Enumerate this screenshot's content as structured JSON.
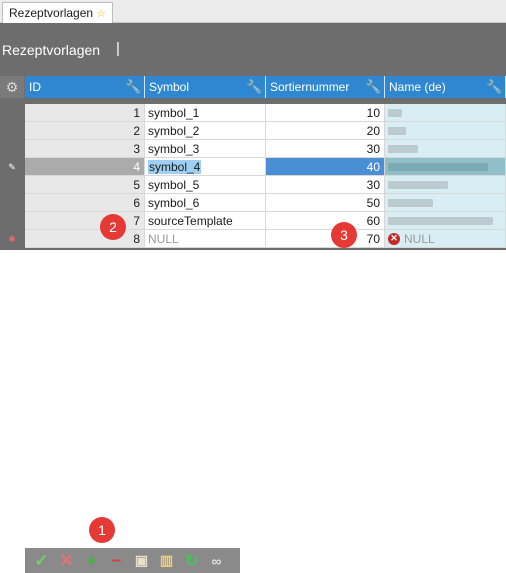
{
  "tab": {
    "label": "Rezeptvorlagen"
  },
  "header": {
    "title": "Rezeptvorlagen",
    "cursor": "|"
  },
  "grid": {
    "columns": [
      "ID",
      "Symbol",
      "Sortiernummer",
      "Name (de)"
    ],
    "rows": [
      {
        "id": "1",
        "symbol": "symbol_1",
        "sort": "10"
      },
      {
        "id": "2",
        "symbol": "symbol_2",
        "sort": "20"
      },
      {
        "id": "3",
        "symbol": "symbol_3",
        "sort": "30"
      },
      {
        "id": "4",
        "symbol": "symbol_4",
        "sort": "40"
      },
      {
        "id": "5",
        "symbol": "symbol_5",
        "sort": "30"
      },
      {
        "id": "6",
        "symbol": "symbol_6",
        "sort": "50"
      },
      {
        "id": "7",
        "symbol": "sourceTemplate",
        "sort": "60"
      },
      {
        "id": "8",
        "symbol": "NULL",
        "sort": "70",
        "name": "NULL"
      }
    ]
  },
  "badges": {
    "one": "1",
    "two": "2",
    "three": "3"
  },
  "colors": {
    "header_blue": "#2f87d1",
    "selected_blue": "#4a8fd4",
    "badge_red": "#e53935"
  },
  "toolbar_icons": [
    "check-icon",
    "delete-x-icon",
    "add-plus-icon",
    "remove-minus-icon",
    "paste-icon",
    "columns-icon",
    "refresh-icon",
    "find-binoculars-icon"
  ]
}
